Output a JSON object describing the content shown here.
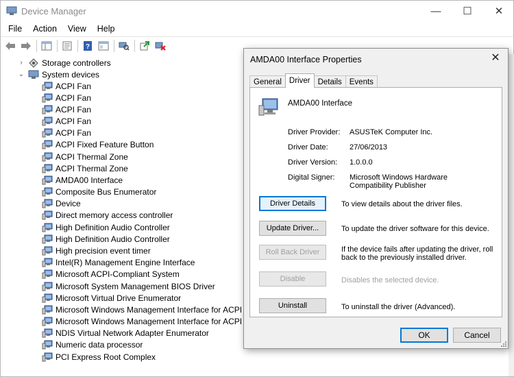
{
  "window": {
    "title": "Device Manager",
    "minimize_glyph": "—",
    "maximize_glyph": "☐",
    "close_glyph": "✕"
  },
  "menu": [
    "File",
    "Action",
    "View",
    "Help"
  ],
  "tree": {
    "categories": [
      {
        "label": "Storage controllers",
        "expanded": false
      },
      {
        "label": "System devices",
        "expanded": true
      }
    ],
    "devices": [
      "ACPI Fan",
      "ACPI Fan",
      "ACPI Fan",
      "ACPI Fan",
      "ACPI Fan",
      "ACPI Fixed Feature Button",
      "ACPI Thermal Zone",
      "ACPI Thermal Zone",
      "AMDA00 Interface",
      "Composite Bus Enumerator",
      "Device",
      "Direct memory access controller",
      "High Definition Audio Controller",
      "High Definition Audio Controller",
      "High precision event timer",
      "Intel(R) Management Engine Interface",
      "Microsoft ACPI-Compliant System",
      "Microsoft System Management BIOS Driver",
      "Microsoft Virtual Drive Enumerator",
      "Microsoft Windows Management Interface for ACPI",
      "Microsoft Windows Management Interface for ACPI",
      "NDIS Virtual Network Adapter Enumerator",
      "Numeric data processor",
      "PCI Express Root Complex"
    ]
  },
  "dialog": {
    "title": "AMDA00 Interface Properties",
    "close_glyph": "✕",
    "tabs": [
      "General",
      "Driver",
      "Details",
      "Events"
    ],
    "active_tab": "Driver",
    "device_name": "AMDA00 Interface",
    "info": {
      "provider_label": "Driver Provider:",
      "provider_value": "ASUSTeK Computer Inc.",
      "date_label": "Driver Date:",
      "date_value": "27/06/2013",
      "version_label": "Driver Version:",
      "version_value": "1.0.0.0",
      "signer_label": "Digital Signer:",
      "signer_value": "Microsoft Windows Hardware Compatibility Publisher"
    },
    "actions": [
      {
        "label": "Driver Details",
        "desc": "To view details about the driver files.",
        "enabled": true
      },
      {
        "label": "Update Driver...",
        "desc": "To update the driver software for this device.",
        "enabled": true
      },
      {
        "label": "Roll Back Driver",
        "desc": "If the device fails after updating the driver, roll back to the previously installed driver.",
        "enabled": false
      },
      {
        "label": "Disable",
        "desc": "Disables the selected device.",
        "enabled": false
      },
      {
        "label": "Uninstall",
        "desc": "To uninstall the driver (Advanced).",
        "enabled": true
      }
    ],
    "ok_label": "OK",
    "cancel_label": "Cancel"
  },
  "colors": {
    "accent": "#0078d7",
    "disabled_text": "#a0a0a0",
    "dialog_bg": "#f0f0f0"
  }
}
